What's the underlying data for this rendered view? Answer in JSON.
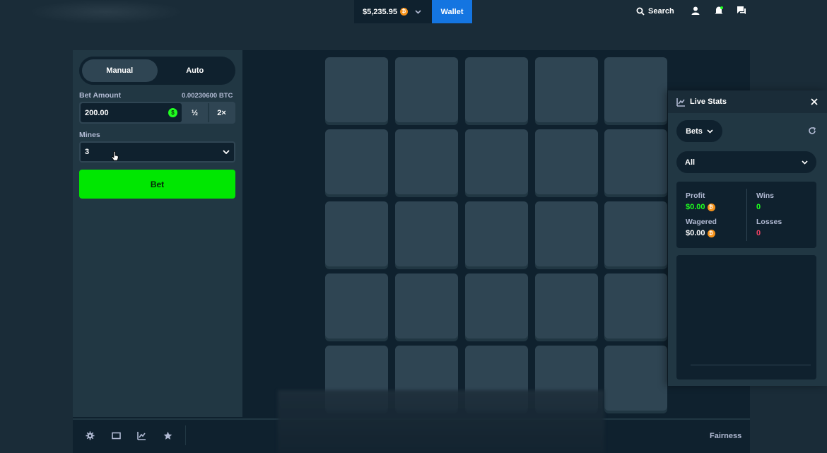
{
  "header": {
    "balance": "$5,235.95",
    "wallet_label": "Wallet",
    "search_label": "Search",
    "icons": [
      "search-icon",
      "user-icon",
      "bell-icon",
      "chat-icon"
    ]
  },
  "sidebar": {
    "tabs": [
      {
        "label": "Manual",
        "active": true
      },
      {
        "label": "Auto",
        "active": false
      }
    ],
    "bet_amount_label": "Bet Amount",
    "bet_amount_btc": "0.00230600 BTC",
    "bet_amount_value": "200.00",
    "half_label": "½",
    "double_label": "2×",
    "mines_label": "Mines",
    "mines_value": "3",
    "bet_button_label": "Bet"
  },
  "footer": {
    "icons": [
      "settings-icon",
      "theatre-icon",
      "stats-icon",
      "favorite-icon"
    ],
    "fairness_label": "Fairness"
  },
  "live_stats": {
    "title": "Live Stats",
    "bets_dropdown": "Bets",
    "filter_dropdown": "All",
    "profit_label": "Profit",
    "profit_value": "$0.00",
    "wins_label": "Wins",
    "wins_value": "0",
    "wagered_label": "Wagered",
    "wagered_value": "$0.00",
    "losses_label": "Losses",
    "losses_value": "0"
  },
  "colors": {
    "accent_green": "#00e701",
    "wallet_blue": "#1475e1",
    "profit_green": "#1fff20",
    "loss_red": "#ed4163"
  }
}
